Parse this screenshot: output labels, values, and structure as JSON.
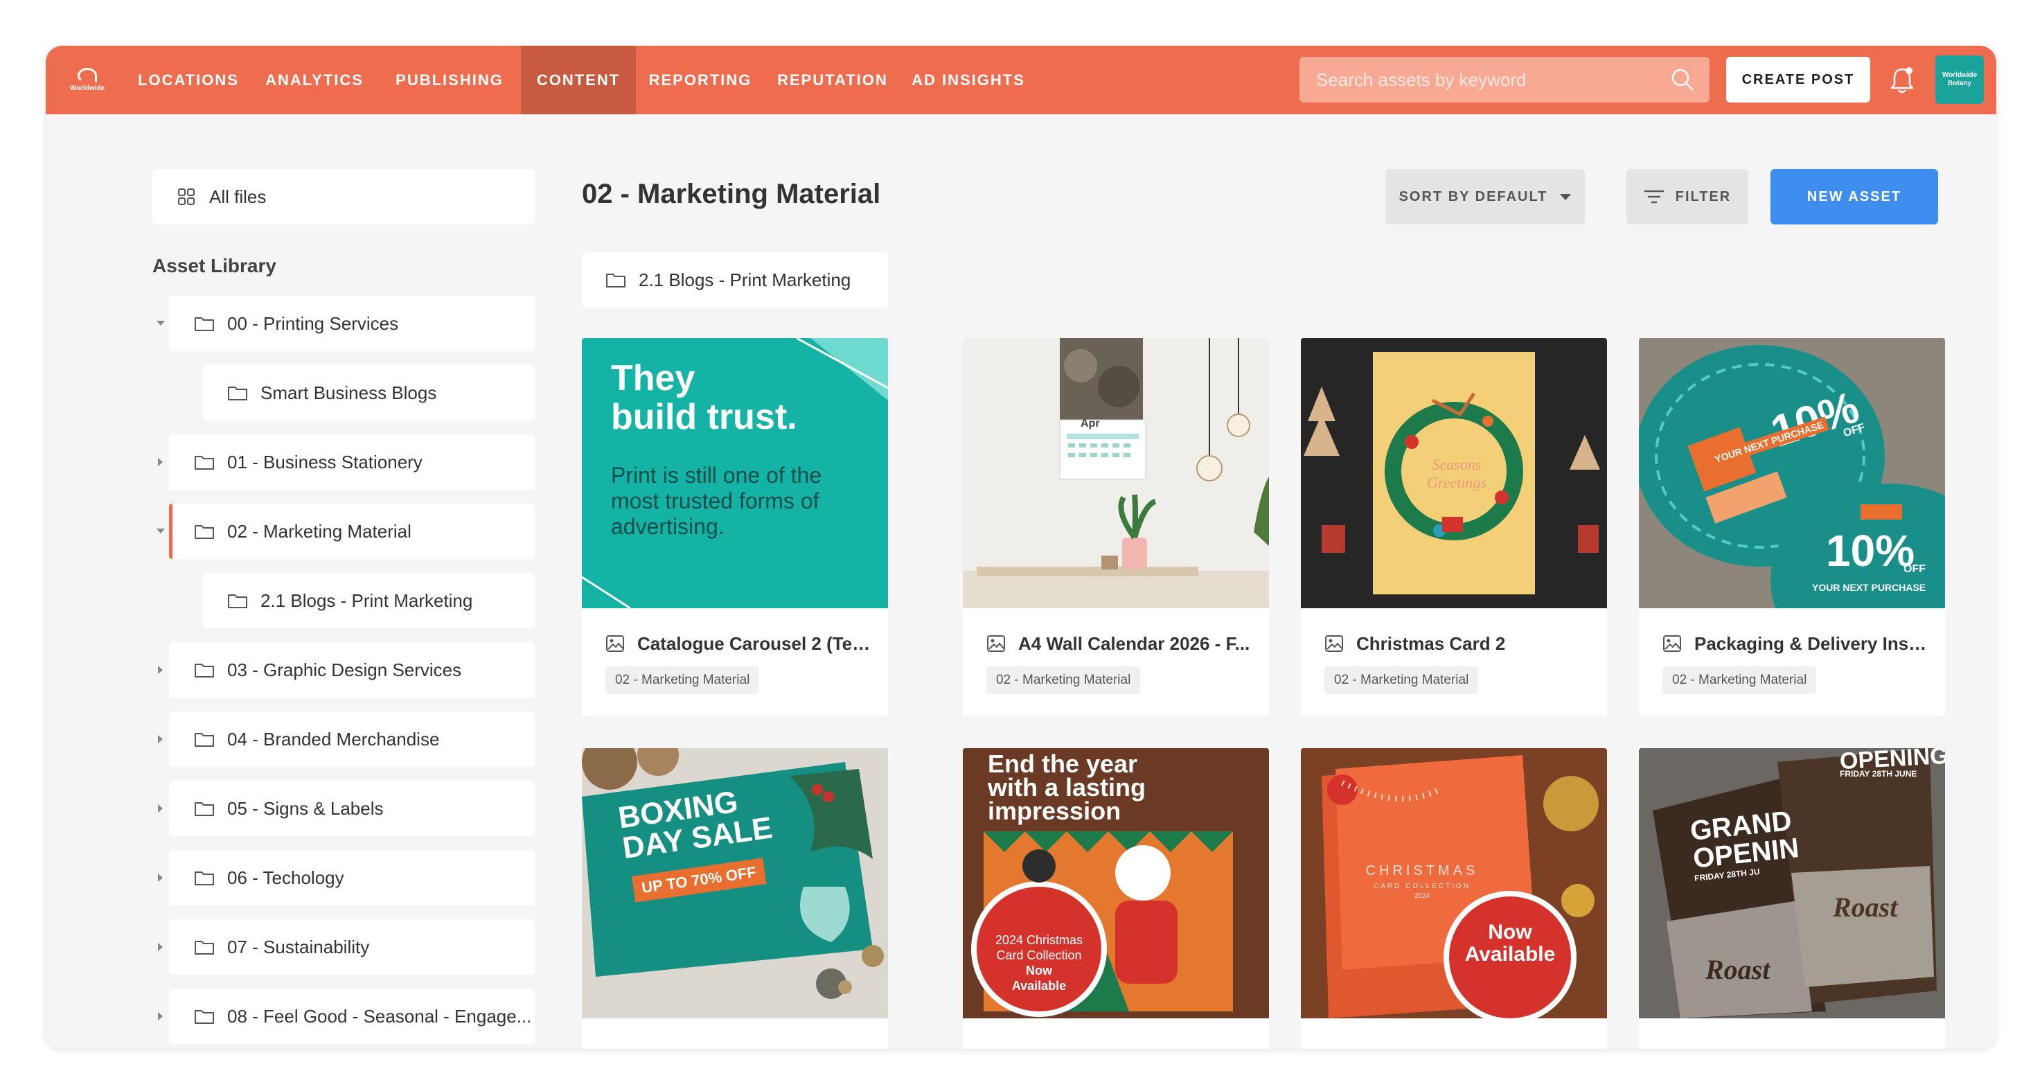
{
  "nav": {
    "logo_text": "Worldwide",
    "items": [
      "LOCATIONS",
      "ANALYTICS",
      "PUBLISHING",
      "CONTENT",
      "REPORTING",
      "REPUTATION",
      "AD INSIGHTS"
    ],
    "active": "CONTENT",
    "search_placeholder": "Search assets by keyword",
    "create_post": "CREATE POST",
    "avatar_text": "Worldwide Botany"
  },
  "sidebar": {
    "all_files": "All files",
    "library_title": "Asset Library",
    "items": [
      {
        "label": "00 - Printing Services",
        "expanded": true
      },
      {
        "label": "Smart Business Blogs",
        "child": true
      },
      {
        "label": "01 - Business Stationery"
      },
      {
        "label": "02 - Marketing Material",
        "expanded": true,
        "active": true
      },
      {
        "label": "2.1 Blogs - Print Marketing",
        "child": true
      },
      {
        "label": "03 - Graphic Design Services"
      },
      {
        "label": "04 - Branded Merchandise"
      },
      {
        "label": "05 - Signs & Labels"
      },
      {
        "label": "06 - Techology"
      },
      {
        "label": "07 - Sustainability"
      },
      {
        "label": "08 - Feel Good - Seasonal - Engage..."
      }
    ]
  },
  "main": {
    "title": "02 - Marketing Material",
    "sort_label": "SORT BY DEFAULT",
    "filter_label": "FILTER",
    "new_asset_label": "NEW ASSET",
    "subfolder": "2.1 Blogs - Print Marketing",
    "cards": [
      {
        "title": "Catalogue Carousel 2 (Text...",
        "tag": "02 - Marketing Material"
      },
      {
        "title": "A4 Wall Calendar 2026 - F...",
        "tag": "02 - Marketing Material"
      },
      {
        "title": "Christmas Card 2",
        "tag": "02 - Marketing Material"
      },
      {
        "title": "Packaging & Delivery Inse...",
        "tag": "02 - Marketing Material"
      }
    ]
  },
  "thumbs": {
    "trust_headline_1": "They",
    "trust_headline_2": "build trust.",
    "trust_body": "Print is still one of the most trusted forms of advertising.",
    "calendar_month": "Apr",
    "xmas_card_text": "Seasons Greetings",
    "coupon_big": "10%",
    "coupon_off": "OFF",
    "coupon_sub": "YOUR NEXT PURCHASE",
    "boxing_1": "BOXING",
    "boxing_2": "DAY SALE",
    "boxing_3": "UP TO 70% OFF",
    "endyear_1": "End the year",
    "endyear_2": "with a lasting",
    "endyear_3": "impression",
    "endyear_badge_1": "2024 Christmas",
    "endyear_badge_2": "Card Collection",
    "endyear_badge_3": "Now",
    "endyear_badge_4": "Available",
    "christmas_word": "CHRISTMAS",
    "christmas_sub": "CARD COLLECTION",
    "christmas_year": "2024",
    "now_available_1": "Now",
    "now_available_2": "Available",
    "opening_1": "GRAND",
    "opening_2": "OPENIN",
    "opening_top": "OPENING",
    "opening_date": "FRIDAY 28TH JUNE",
    "opening_date_2": "FRIDAY 28TH JU",
    "roast": "Roast"
  },
  "colors": {
    "nav": "#ef6d4f",
    "nav_active": "#c85a40",
    "primary_button": "#3e8ef0",
    "teal": "#14b3a5"
  }
}
